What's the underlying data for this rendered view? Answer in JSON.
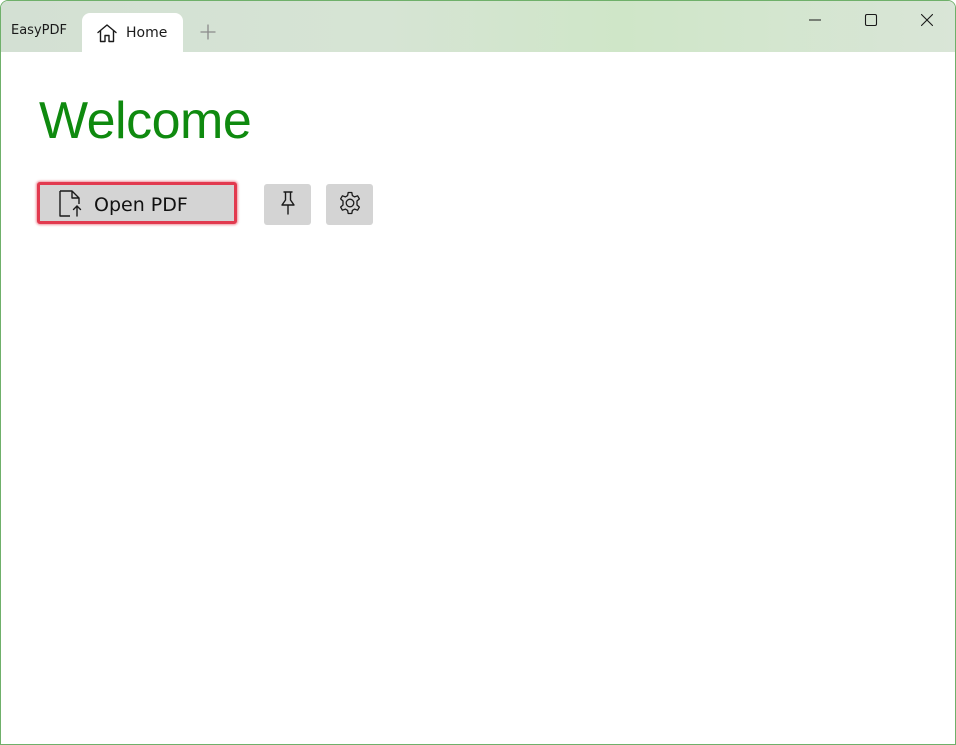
{
  "titlebar": {
    "app_name": "EasyPDF",
    "tabs": [
      {
        "label": "Home",
        "icon": "home-icon"
      }
    ],
    "new_tab_icon": "plus-icon",
    "caption_buttons": [
      "minimize-icon",
      "maximize-icon",
      "close-icon"
    ]
  },
  "main": {
    "title": "Welcome",
    "open_pdf_label": "Open PDF",
    "open_pdf_icon": "file-upload-icon",
    "pin_icon": "pin-icon",
    "settings_icon": "gear-icon"
  },
  "colors": {
    "accent": "#0f8a0f",
    "button_bg": "#d4d4d4",
    "focus_outline": "#e23a4f",
    "window_border": "#6fb06a"
  }
}
